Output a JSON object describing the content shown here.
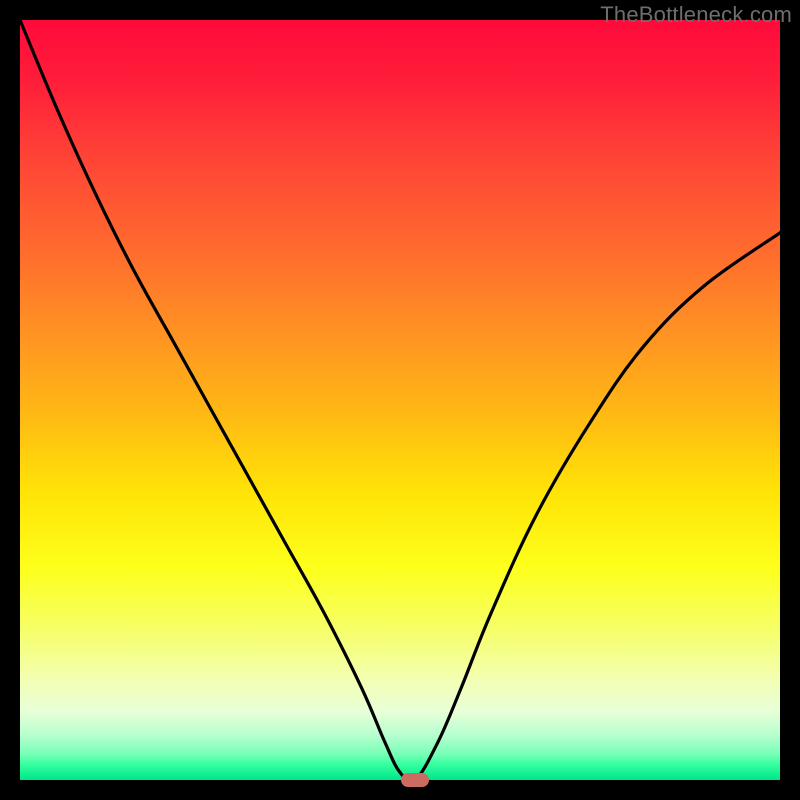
{
  "watermark": "TheBottleneck.com",
  "colors": {
    "frame": "#000000",
    "curve": "#000000",
    "marker": "#cc6b61",
    "gradient_top": "#ff0a3b",
    "gradient_bottom": "#00e58a"
  },
  "chart_data": {
    "type": "line",
    "title": "",
    "xlabel": "",
    "ylabel": "",
    "xlim": [
      0,
      100
    ],
    "ylim": [
      0,
      100
    ],
    "grid": false,
    "legend": false,
    "series": [
      {
        "name": "curve",
        "x": [
          0,
          5,
          10,
          15,
          20,
          25,
          30,
          35,
          40,
          45,
          48,
          50,
          52,
          55,
          58,
          62,
          68,
          75,
          82,
          90,
          100
        ],
        "y": [
          100,
          88,
          77,
          67,
          58,
          49,
          40,
          31,
          22,
          12,
          5,
          1,
          0,
          5,
          12,
          22,
          35,
          47,
          57,
          65,
          72
        ]
      }
    ],
    "marker": {
      "x": 52,
      "y": 0
    }
  }
}
